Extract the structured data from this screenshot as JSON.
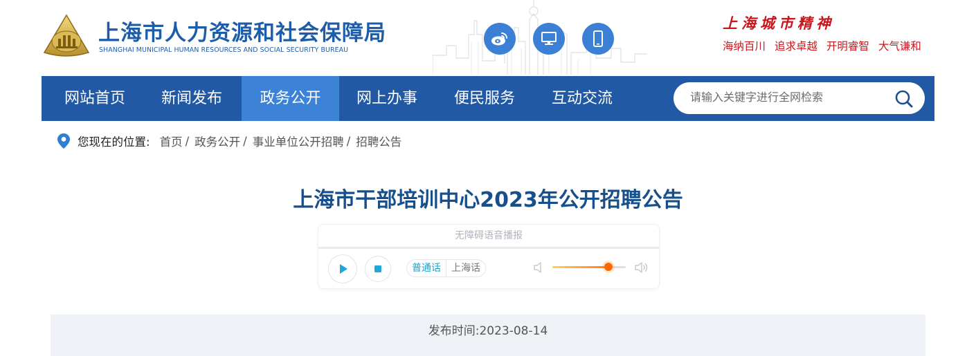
{
  "header": {
    "org_name_cn": "上海市人力资源和社会保障局",
    "org_name_en": "SHANGHAI MUNICIPAL HUMAN RESOURCES AND SOCIAL SECURITY BUREAU",
    "icons": [
      "weibo-icon",
      "desktop-icon",
      "mobile-icon"
    ],
    "spirit_title": "上海城市精神",
    "spirit_words": [
      "海纳百川",
      "追求卓越",
      "开明睿智",
      "大气谦和"
    ]
  },
  "nav": {
    "items": [
      {
        "label": "网站首页",
        "active": false
      },
      {
        "label": "新闻发布",
        "active": false
      },
      {
        "label": "政务公开",
        "active": true
      },
      {
        "label": "网上办事",
        "active": false
      },
      {
        "label": "便民服务",
        "active": false
      },
      {
        "label": "互动交流",
        "active": false
      }
    ],
    "search_placeholder": "请输入关键字进行全网检索"
  },
  "breadcrumb": {
    "lead": "您现在的位置:",
    "items": [
      "首页",
      "政务公开",
      "事业单位公开招聘",
      "招聘公告"
    ],
    "separator": "/"
  },
  "article": {
    "title": "上海市干部培训中心2023年公开招聘公告",
    "publish_label": "发布时间:",
    "publish_date": "2023-08-14"
  },
  "player": {
    "header": "无障碍语音播报",
    "lang_options": [
      "普通话",
      "上海话"
    ],
    "selected_lang": "普通话",
    "volume": 0.76
  },
  "colors": {
    "nav_bg": "#2159a5",
    "nav_active": "#3c82d6",
    "title": "#164f8b",
    "spirit": "#c8161d"
  }
}
